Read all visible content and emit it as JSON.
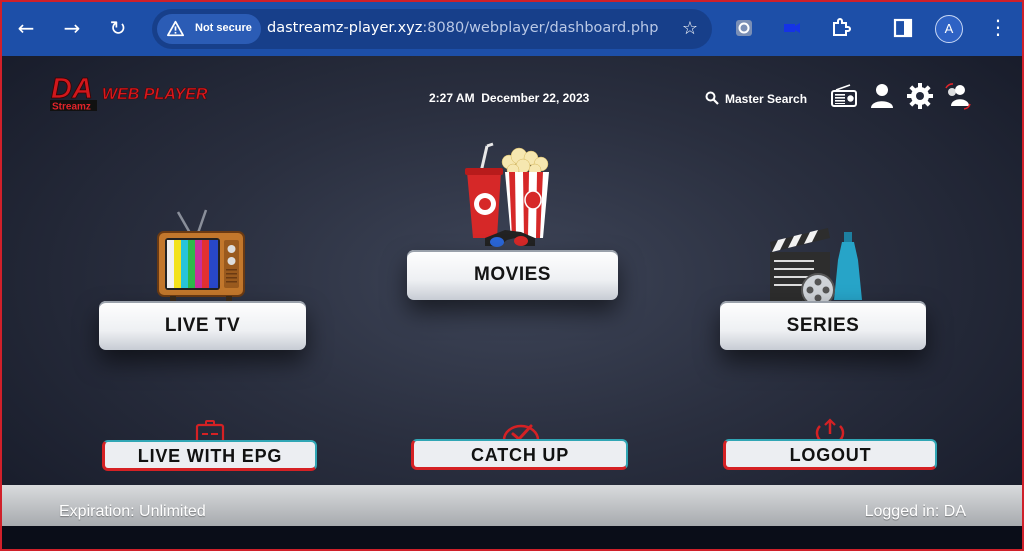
{
  "browser": {
    "security_label": "Not secure",
    "url_host": "dastreamz-player.xyz",
    "url_rest": ":8080/webplayer/dashboard.php",
    "profile_initial": "A",
    "icons": [
      "back-arrow-icon",
      "forward-arrow-icon",
      "reload-icon",
      "warning-icon",
      "star-icon",
      "extensions-puzzle-icon",
      "sidebar-panel-icon",
      "kebab-menu-icon"
    ]
  },
  "header": {
    "logo_big": "DA",
    "logo_small": "Streamz",
    "logo_title": "WEB PLAYER",
    "time": "2:27 AM",
    "date": "December 22, 2023",
    "search_label": "Master Search"
  },
  "tiles": {
    "live_tv": "LIVE TV",
    "movies": "MOVIES",
    "series": "SERIES"
  },
  "actions": {
    "live_epg": "LIVE WITH EPG",
    "catch_up": "CATCH UP",
    "logout": "LOGOUT"
  },
  "footer": {
    "expiration": "Expiration: Unlimited",
    "logged_in": "Logged in: DA"
  },
  "colors": {
    "browser_bar": "#1d4fa8",
    "accent_red": "#d52124",
    "accent_teal": "#30a6b5"
  }
}
